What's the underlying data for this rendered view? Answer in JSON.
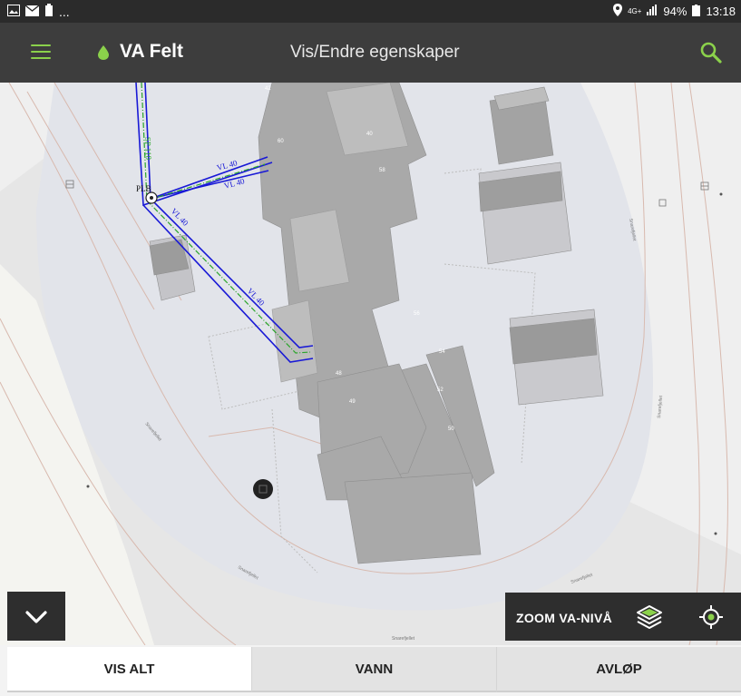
{
  "status_bar": {
    "overflow": "...",
    "network": "4G+",
    "battery": "94%",
    "time": "13:18"
  },
  "app_bar": {
    "app_title": "VA Felt",
    "screen_title": "Vis/Endre egenskaper",
    "accent_color": "#8bd14b"
  },
  "map": {
    "pipe_labels": [
      "VL 40",
      "VL 40",
      "VL 40",
      "VL 40",
      "SP 110"
    ],
    "building_numbers": [
      "42",
      "60",
      "40",
      "58",
      "56",
      "54",
      "52",
      "48",
      "49",
      "50"
    ],
    "street_labels": [
      "Snarefjellet",
      "Snarefjellet",
      "Snarefjellet",
      "Snarefjellet",
      "Snarefjellet",
      "Snarefjellet"
    ],
    "point_label": "PLB"
  },
  "controls": {
    "zoom_label": "ZOOM VA-NIVÅ"
  },
  "tabs": [
    {
      "label": "VIS ALT",
      "active": true
    },
    {
      "label": "VANN",
      "active": false
    },
    {
      "label": "AVLØP",
      "active": false
    }
  ]
}
